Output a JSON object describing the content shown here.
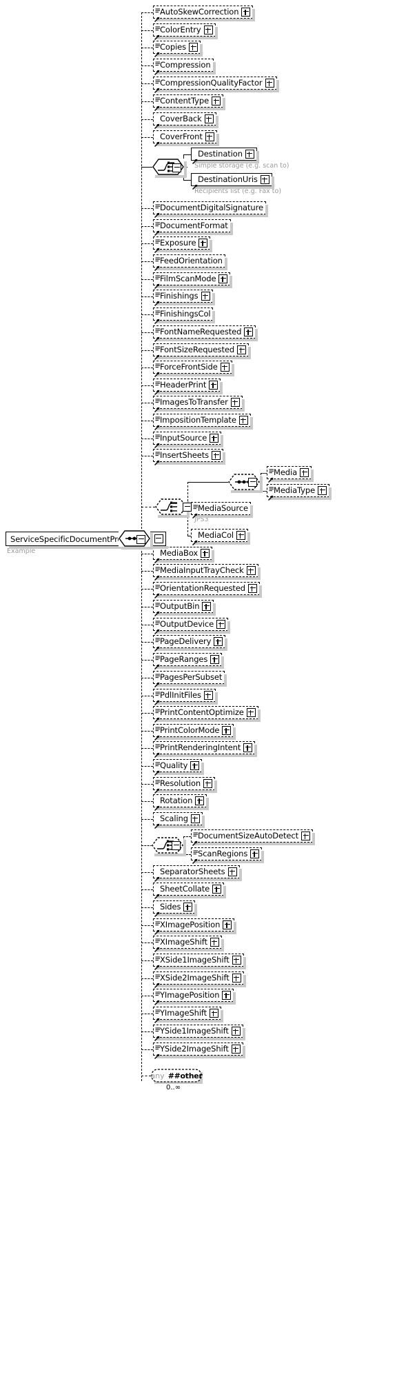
{
  "diagram": {
    "type": "xsd-schema-diagram",
    "root": {
      "name": "ServiceSpecificDocumentProcessing",
      "annotation": "Example",
      "compositor": "sequence"
    },
    "colors": {
      "line": "#000000",
      "box_fill": "#ffffff",
      "shadow": "#c9c9c9",
      "annotation_text": "#9a9a9a",
      "label_text": "#000000"
    },
    "icons": {
      "expand": "plus-icon",
      "collapse": "minus-icon",
      "choice": "choice-compositor-icon",
      "sequence": "sequence-compositor-icon",
      "element_ref": "element-reference-arrow-icon",
      "simple_type": "simple-type-lines-icon"
    },
    "children": [
      {
        "id": "autoskewcorrection",
        "label": "AutoSkewCorrection",
        "optional": true,
        "plus": true,
        "lines": true
      },
      {
        "id": "colorentry",
        "label": "ColorEntry",
        "optional": true,
        "plus": true,
        "lines": true
      },
      {
        "id": "copies",
        "label": "Copies",
        "optional": true,
        "plus": true,
        "lines": true
      },
      {
        "id": "compression",
        "label": "Compression",
        "optional": true,
        "plus": false,
        "lines": true
      },
      {
        "id": "compressionqualityfactor",
        "label": "CompressionQualityFactor",
        "optional": true,
        "plus": true,
        "lines": true
      },
      {
        "id": "contenttype",
        "label": "ContentType",
        "optional": true,
        "plus": true,
        "lines": true
      },
      {
        "id": "coverback",
        "label": "CoverBack",
        "optional": true,
        "plus": true,
        "lines": false
      },
      {
        "id": "coverfront",
        "label": "CoverFront",
        "optional": true,
        "plus": true,
        "lines": false
      },
      {
        "id": "destination",
        "label": "Destination",
        "optional": false,
        "plus": true,
        "lines": false,
        "annotation": "Simple storage (e.g. scan to)"
      },
      {
        "id": "destinationuris",
        "label": "DestinationUris",
        "optional": false,
        "plus": true,
        "lines": false,
        "annotation": "Recipients list (e.g. Fax to)"
      },
      {
        "id": "documentdigitalsignature",
        "label": "DocumentDigitalSignature",
        "optional": true,
        "plus": false,
        "lines": true
      },
      {
        "id": "documentformat",
        "label": "DocumentFormat",
        "optional": true,
        "plus": false,
        "lines": true
      },
      {
        "id": "exposure",
        "label": "Exposure",
        "optional": true,
        "plus": true,
        "lines": true
      },
      {
        "id": "feedorientation",
        "label": "FeedOrientation",
        "optional": true,
        "plus": false,
        "lines": true
      },
      {
        "id": "filmscanmode",
        "label": "FilmScanMode",
        "optional": true,
        "plus": true,
        "lines": true
      },
      {
        "id": "finishings",
        "label": "Finishings",
        "optional": true,
        "plus": true,
        "lines": true
      },
      {
        "id": "finishingscol",
        "label": "FinishingsCol",
        "optional": true,
        "plus": false,
        "lines": true
      },
      {
        "id": "fontnamerequested",
        "label": "FontNameRequested",
        "optional": true,
        "plus": true,
        "lines": true
      },
      {
        "id": "fontsizerequested",
        "label": "FontSizeRequested",
        "optional": true,
        "plus": true,
        "lines": true
      },
      {
        "id": "forcefrontside",
        "label": "ForceFrontSide",
        "optional": true,
        "plus": true,
        "lines": true
      },
      {
        "id": "headerprint",
        "label": "HeaderPrint",
        "optional": true,
        "plus": true,
        "lines": true
      },
      {
        "id": "imagestotransfer",
        "label": "ImagesToTransfer",
        "optional": true,
        "plus": true,
        "lines": true
      },
      {
        "id": "impositiontemplate",
        "label": "ImpositionTemplate",
        "optional": true,
        "plus": true,
        "lines": true
      },
      {
        "id": "inputsource",
        "label": "InputSource",
        "optional": true,
        "plus": true,
        "lines": true
      },
      {
        "id": "insertsheets",
        "label": "InsertSheets",
        "optional": true,
        "plus": true,
        "lines": true
      },
      {
        "id": "media",
        "label": "Media",
        "optional": true,
        "plus": true,
        "lines": true
      },
      {
        "id": "mediatype",
        "label": "MediaType",
        "optional": true,
        "plus": true,
        "lines": true
      },
      {
        "id": "mediasource",
        "label": "MediaSource",
        "optional": true,
        "plus": false,
        "lines": true,
        "annotation": "JPS3"
      },
      {
        "id": "mediacol",
        "label": "MediaCol",
        "optional": true,
        "plus": true,
        "lines": false
      },
      {
        "id": "mediabox",
        "label": "MediaBox",
        "optional": true,
        "plus": true,
        "lines": false
      },
      {
        "id": "mediainputtraycheck",
        "label": "MediaInputTrayCheck",
        "optional": true,
        "plus": true,
        "lines": true
      },
      {
        "id": "orientationrequested",
        "label": "OrientationRequested",
        "optional": true,
        "plus": true,
        "lines": true
      },
      {
        "id": "outputbin",
        "label": "OutputBin",
        "optional": true,
        "plus": true,
        "lines": true
      },
      {
        "id": "outputdevice",
        "label": "OutputDevice",
        "optional": true,
        "plus": true,
        "lines": true
      },
      {
        "id": "pagedelivery",
        "label": "PageDelivery",
        "optional": true,
        "plus": true,
        "lines": true
      },
      {
        "id": "pageranges",
        "label": "PageRanges",
        "optional": true,
        "plus": true,
        "lines": true
      },
      {
        "id": "pagespersubset",
        "label": "PagesPerSubset",
        "optional": true,
        "plus": false,
        "lines": true
      },
      {
        "id": "pdlinitfiles",
        "label": "PdlInitFiles",
        "optional": true,
        "plus": true,
        "lines": true
      },
      {
        "id": "printcontentoptimize",
        "label": "PrintContentOptimize",
        "optional": true,
        "plus": true,
        "lines": true
      },
      {
        "id": "printcolormode",
        "label": "PrintColorMode",
        "optional": true,
        "plus": true,
        "lines": true
      },
      {
        "id": "printrenderingintent",
        "label": "PrintRenderingIntent",
        "optional": true,
        "plus": true,
        "lines": true
      },
      {
        "id": "quality",
        "label": "Quality",
        "optional": true,
        "plus": true,
        "lines": true
      },
      {
        "id": "resolution",
        "label": "Resolution",
        "optional": true,
        "plus": true,
        "lines": true
      },
      {
        "id": "rotation",
        "label": "Rotation",
        "optional": true,
        "plus": true,
        "lines": false
      },
      {
        "id": "scaling",
        "label": "Scaling",
        "optional": true,
        "plus": true,
        "lines": false
      },
      {
        "id": "documentsizeautodetect",
        "label": "DocumentSizeAutoDetect",
        "optional": true,
        "plus": true,
        "lines": true
      },
      {
        "id": "scanregions",
        "label": "ScanRegions",
        "optional": true,
        "plus": true,
        "lines": true
      },
      {
        "id": "separatorsheets",
        "label": "SeparatorSheets",
        "optional": true,
        "plus": true,
        "lines": false
      },
      {
        "id": "sheetcollate",
        "label": "SheetCollate",
        "optional": true,
        "plus": true,
        "lines": false
      },
      {
        "id": "sides",
        "label": "Sides",
        "optional": true,
        "plus": true,
        "lines": false
      },
      {
        "id": "ximageposition",
        "label": "XImagePosition",
        "optional": true,
        "plus": true,
        "lines": true
      },
      {
        "id": "ximageshift",
        "label": "XImageShift",
        "optional": true,
        "plus": true,
        "lines": true
      },
      {
        "id": "xside1imageshift",
        "label": "XSide1ImageShift",
        "optional": true,
        "plus": true,
        "lines": true
      },
      {
        "id": "xside2imageshift",
        "label": "XSide2ImageShift",
        "optional": true,
        "plus": true,
        "lines": true
      },
      {
        "id": "yimageposition",
        "label": "YImagePosition",
        "optional": true,
        "plus": true,
        "lines": true
      },
      {
        "id": "yimageshift",
        "label": "YImageShift",
        "optional": true,
        "plus": true,
        "lines": true
      },
      {
        "id": "yside1imageshift",
        "label": "YSide1ImageShift",
        "optional": true,
        "plus": true,
        "lines": true
      },
      {
        "id": "yside2imageshift",
        "label": "YSide2ImageShift",
        "optional": true,
        "plus": true,
        "lines": true
      }
    ],
    "wildcard": {
      "any_label": "any",
      "namespace": "##other",
      "occurs": "0..∞"
    }
  }
}
